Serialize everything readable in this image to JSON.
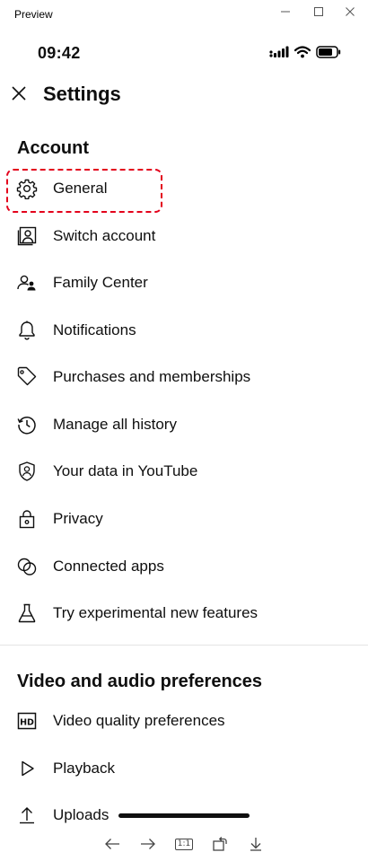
{
  "window": {
    "title": "Preview"
  },
  "status": {
    "time": "09:42"
  },
  "header": {
    "title": "Settings"
  },
  "sections": [
    {
      "title": "Account",
      "items": [
        {
          "label": "General",
          "icon": "gear-icon"
        },
        {
          "label": "Switch account",
          "icon": "switch-account-icon"
        },
        {
          "label": "Family Center",
          "icon": "family-center-icon"
        },
        {
          "label": "Notifications",
          "icon": "bell-icon"
        },
        {
          "label": "Purchases and memberships",
          "icon": "tag-icon"
        },
        {
          "label": "Manage all history",
          "icon": "history-icon"
        },
        {
          "label": "Your data in YouTube",
          "icon": "shield-person-icon"
        },
        {
          "label": "Privacy",
          "icon": "lock-icon"
        },
        {
          "label": "Connected apps",
          "icon": "connected-apps-icon"
        },
        {
          "label": "Try experimental new features",
          "icon": "flask-icon"
        }
      ]
    },
    {
      "title": "Video and audio preferences",
      "items": [
        {
          "label": "Video quality preferences",
          "icon": "hd-icon"
        },
        {
          "label": "Playback",
          "icon": "play-icon"
        },
        {
          "label": "Uploads",
          "icon": "upload-icon"
        }
      ]
    }
  ],
  "toolbar": {
    "actual_size_label": "1:1"
  },
  "colors": {
    "highlight": "#e3001b",
    "text": "#0f0f0f",
    "divider": "#e5e5e5"
  }
}
